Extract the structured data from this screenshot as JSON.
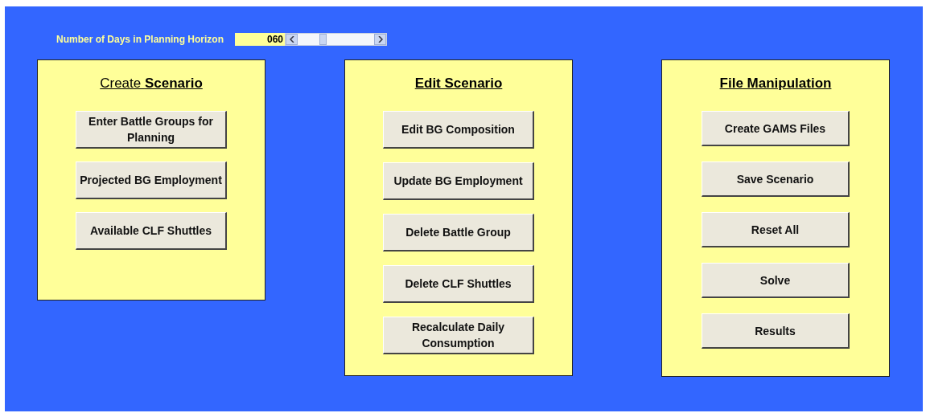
{
  "horizon": {
    "label": "Number of Days in Planning Horizon",
    "value": "060"
  },
  "panels": [
    {
      "title": "Create **Scenario**",
      "buttons": [
        "Enter Battle Groups for Planning",
        "Projected BG Employment",
        "Available CLF Shuttles"
      ]
    },
    {
      "title": "**Edit Scenario**",
      "buttons": [
        "Edit BG Composition",
        "Update BG Employment",
        "Delete Battle Group",
        "Delete CLF Shuttles",
        "Recalculate Daily Consumption"
      ]
    },
    {
      "title": "**File Manipulation**",
      "buttons": [
        "Create GAMS Files",
        "Save Scenario",
        "Reset All",
        "Solve",
        "Results"
      ]
    }
  ]
}
